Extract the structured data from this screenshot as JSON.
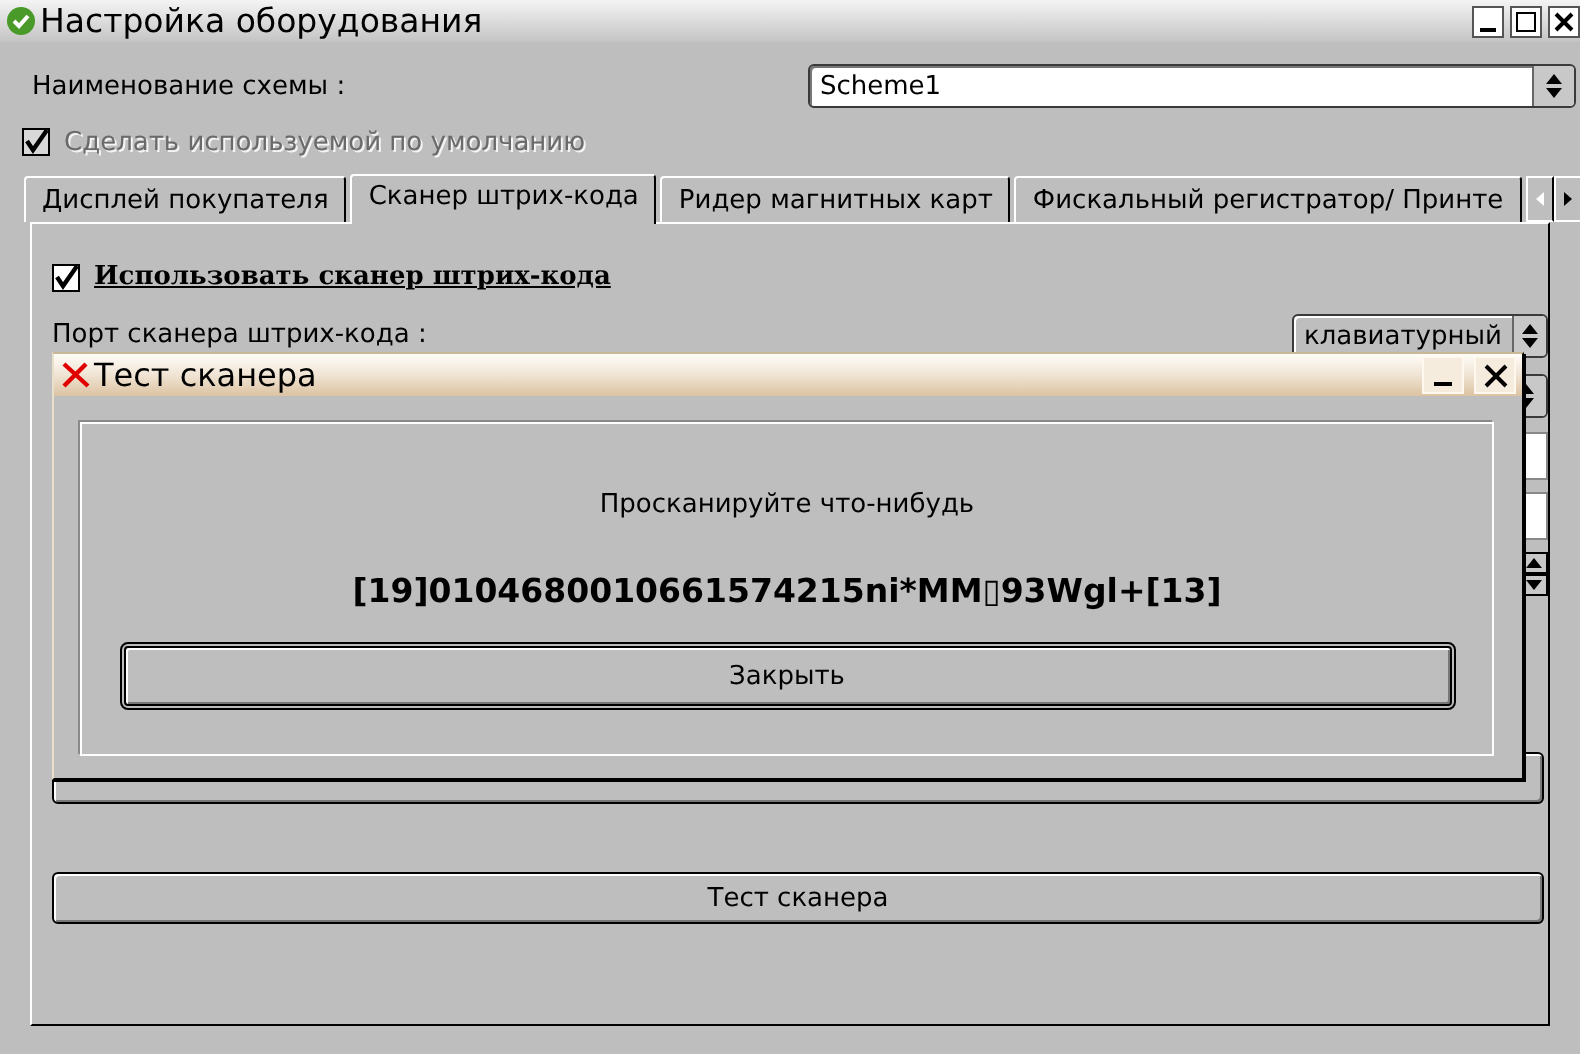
{
  "window": {
    "title": "Настройка оборудования"
  },
  "scheme": {
    "label": "Наименование схемы :",
    "value": "Scheme1"
  },
  "default_checkbox": {
    "label": "Сделать используемой по умолчанию",
    "checked": true,
    "disabled": true
  },
  "tabs": [
    {
      "label": "Дисплей покупателя",
      "selected": false
    },
    {
      "label": "Сканер штрих-кода",
      "selected": true
    },
    {
      "label": "Ридер магнитных карт",
      "selected": false
    },
    {
      "label": "Фискальный регистратор/ Принте",
      "selected": false
    }
  ],
  "scanner_page": {
    "use_checkbox": {
      "label": "Использовать сканер штрих-кода",
      "checked": true
    },
    "port": {
      "label": "Порт сканера штрих-кода :",
      "value": "клавиатурный"
    },
    "test_button": "Тест сканера"
  },
  "dialog": {
    "title": "Тест сканера",
    "prompt": "Просканируйте что-нибудь",
    "scanned": "[19]0104680010661574215ni*MM▯93Wgl+[13]",
    "close_button": "Закрыть"
  }
}
